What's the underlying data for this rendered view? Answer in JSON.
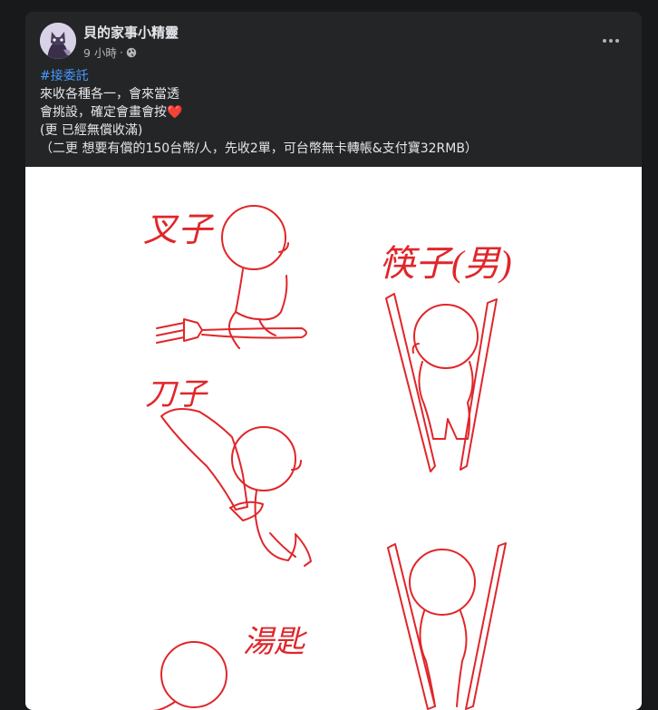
{
  "post": {
    "page_name": "貝的家事小精靈",
    "time": "9 小時",
    "separator": "·",
    "privacy_icon": "globe-icon",
    "more_icon": "more-options-icon",
    "text": {
      "hashtag": "#接委託",
      "line1": "來收各種各一，會來當透",
      "line2": "會挑設，確定會畫會按",
      "line2_emoji": "❤️",
      "line3": "(更 已經無償收滿)",
      "line4": "（二更 想要有償的150台幣/人，先收2單，可台幣無卡轉帳&支付寶32RMB）"
    },
    "image": {
      "labels": {
        "fork": "叉子",
        "knife": "刀子",
        "chopsticks": "筷子(男)",
        "spoon": "湯匙"
      }
    }
  }
}
